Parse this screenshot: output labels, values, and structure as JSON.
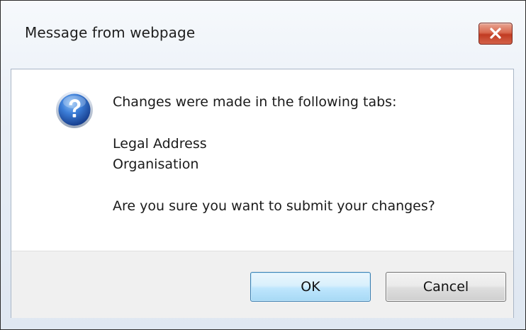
{
  "dialog": {
    "title": "Message from webpage",
    "icon": "question-icon",
    "message": {
      "intro": "Changes were made in the following tabs:",
      "tabs": [
        "Legal Address",
        "Organisation"
      ],
      "question": "Are you sure you want to submit your changes?"
    },
    "buttons": {
      "ok_label": "OK",
      "cancel_label": "Cancel"
    }
  },
  "colors": {
    "close_button": "#c13b22",
    "ok_button_border": "#3c7fb1",
    "question_icon": "#1f5fb5"
  }
}
